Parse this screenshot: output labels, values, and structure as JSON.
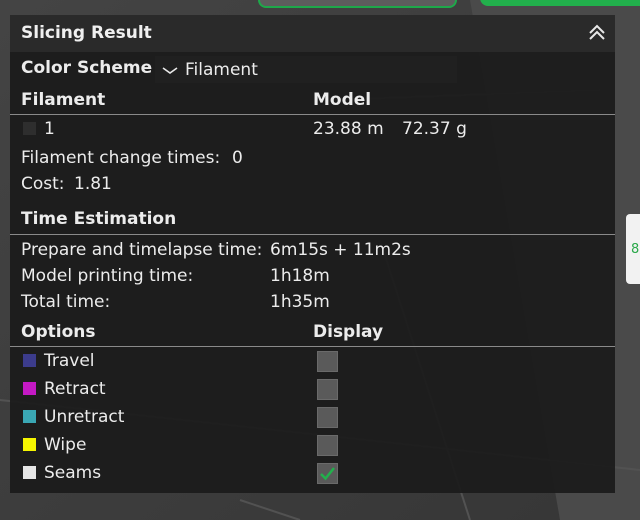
{
  "panel": {
    "title": "Slicing Result",
    "color_scheme": {
      "label": "Color Scheme",
      "selected": "Filament"
    },
    "filament_section": {
      "headers": [
        "Filament",
        "Model"
      ],
      "row": {
        "id": "1",
        "length": "23.88 m",
        "weight": "72.37 g",
        "swatch_color": "#2e2e2e"
      },
      "change_times_label": "Filament change times:",
      "change_times_value": "0",
      "cost_label": "Cost:",
      "cost_value": "1.81"
    },
    "time_section": {
      "header": "Time Estimation",
      "rows": [
        {
          "label": "Prepare and timelapse time:",
          "value": "6m15s + 11m2s"
        },
        {
          "label": "Model printing time:",
          "value": "1h18m"
        },
        {
          "label": "Total time:",
          "value": "1h35m"
        }
      ]
    },
    "options_section": {
      "headers": [
        "Options",
        "Display"
      ],
      "items": [
        {
          "label": "Travel",
          "color": "#3c3c8c",
          "checked": false
        },
        {
          "label": "Retract",
          "color": "#c419c4",
          "checked": false
        },
        {
          "label": "Unretract",
          "color": "#3aa7b4",
          "checked": false
        },
        {
          "label": "Wipe",
          "color": "#f5f500",
          "checked": false
        },
        {
          "label": "Seams",
          "color": "#e6e6e6",
          "checked": true
        }
      ]
    }
  },
  "side_tab_text": "8",
  "colors": {
    "accent": "#22b04c",
    "panel_bg": "#1b1b1b"
  }
}
